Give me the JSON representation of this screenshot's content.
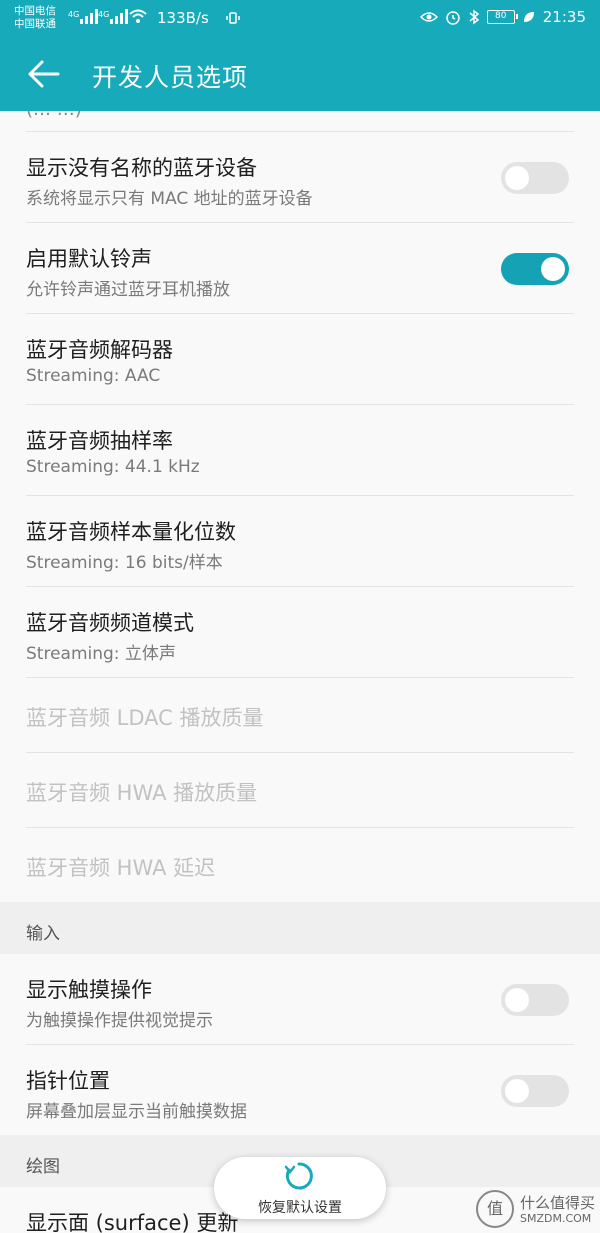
{
  "status_bar": {
    "carrier1": "中国电信",
    "carrier2": "中国联通",
    "net1": "4G",
    "net2": "4G",
    "speed": "133B/s",
    "battery": "80",
    "time": "21:35"
  },
  "app_bar": {
    "title": "开发人员选项"
  },
  "list": {
    "partial_text": "(… …)",
    "items": [
      {
        "title": "显示没有名称的蓝牙设备",
        "subtitle": "系统将显示只有 MAC 地址的蓝牙设备",
        "toggle": false
      },
      {
        "title": "启用默认铃声",
        "subtitle": "允许铃声通过蓝牙耳机播放",
        "toggle": true
      },
      {
        "title": "蓝牙音频解码器",
        "subtitle": "Streaming: AAC"
      },
      {
        "title": "蓝牙音频抽样率",
        "subtitle": "Streaming: 44.1 kHz"
      },
      {
        "title": "蓝牙音频样本量化位数",
        "subtitle": "Streaming: 16 bits/样本"
      },
      {
        "title": "蓝牙音频频道模式",
        "subtitle": "Streaming: 立体声"
      },
      {
        "title": "蓝牙音频 LDAC 播放质量"
      },
      {
        "title": "蓝牙音频 HWA 播放质量"
      },
      {
        "title": "蓝牙音频 HWA 延迟"
      }
    ],
    "section_input": "输入",
    "input_items": [
      {
        "title": "显示触摸操作",
        "subtitle": "为触摸操作提供视觉提示",
        "toggle": false
      },
      {
        "title": "指针位置",
        "subtitle": "屏幕叠加层显示当前触摸数据",
        "toggle": false
      }
    ],
    "section_drawing": "绘图",
    "drawing_items": [
      {
        "title": "显示面 (surface) 更新"
      }
    ]
  },
  "fab": {
    "label": "恢复默认设置"
  },
  "watermark": {
    "logo": "值",
    "line1": "什么值得买",
    "line2": "SMZDM.COM"
  },
  "colors": {
    "accent": "#16aabb",
    "switch_on": "#16a2b5"
  }
}
